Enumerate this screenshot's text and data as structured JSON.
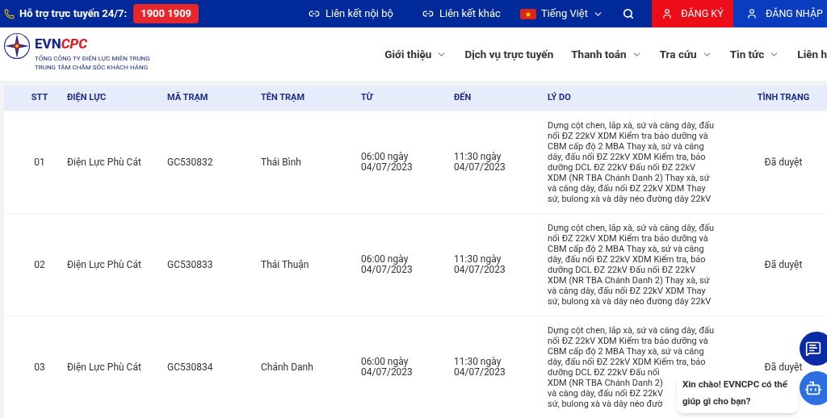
{
  "top_bar": {
    "support_label": "Hỗ trợ trực tuyến 24/7:",
    "hotline": "1900 1909",
    "links": [
      "Liên kết nội bộ",
      "Liên kết khác"
    ],
    "language": "Tiếng Việt",
    "register": "ĐĂNG KÝ",
    "login": "ĐĂNG NHẬP"
  },
  "logo": {
    "brand_a": "EVN",
    "brand_b": "CPC",
    "line_1": "TỔNG CÔNG TY ĐIỆN LỰC MIỀN TRUNG",
    "line_2": "TRUNG TÂM CHĂM SÓC KHÁCH HÀNG"
  },
  "nav": [
    {
      "label": "Giới thiệu",
      "dropdown": true
    },
    {
      "label": "Dịch vụ trực tuyến",
      "dropdown": false
    },
    {
      "label": "Thanh toán",
      "dropdown": true
    },
    {
      "label": "Tra cứu",
      "dropdown": true
    },
    {
      "label": "Tin tức",
      "dropdown": true
    },
    {
      "label": "Liên h",
      "dropdown": false
    }
  ],
  "table": {
    "columns": [
      "STT",
      "ĐIỆN LỰC",
      "MÃ TRẠM",
      "TÊN TRẠM",
      "TỪ",
      "ĐẾN",
      "LÝ DO",
      "TÌNH TRẠNG"
    ],
    "rows": [
      {
        "stt": "01",
        "unit": "Điện Lực Phù Cát",
        "code": "GC530832",
        "name": "Thái Bình",
        "from": "06:00 ngày 04/07/2023",
        "to": "11:30 ngày 04/07/2023",
        "reason": [
          "Dựng cột chen, lắp xà, sứ và căng dây, đấu",
          "nối ĐZ 22kV XDM Kiểm tra bảo dưỡng và",
          "CBM cấp độ 2 MBA Thay xà, sứ và căng",
          "dây, đấu nối ĐZ 22kV XDM Kiểm tra, bảo",
          "dưỡng DCL ĐZ 22kV Đấu nối ĐZ 22kV",
          "XDM (NR TBA Chánh Danh 2) Thay xà, sứ",
          "và căng dây, đấu nối ĐZ 22kV XDM Thay",
          "sứ, bulong xà và dây néo đường dây 22kV"
        ],
        "status": "Đã duyệt"
      },
      {
        "stt": "02",
        "unit": "Điện Lực Phù Cát",
        "code": "GC530833",
        "name": "Thái Thuận",
        "from": "06:00 ngày 04/07/2023",
        "to": "11:30 ngày 04/07/2023",
        "reason": [
          "Dựng cột chen, lắp xà, sứ và căng dây, đấu",
          "nối ĐZ 22kV XDM Kiểm tra bảo dưỡng và",
          "CBM cấp độ 2 MBA Thay xà, sứ và căng",
          "dây, đấu nối ĐZ 22kV XDM Kiểm tra, bảo",
          "dưỡng DCL ĐZ 22kV Đấu nối ĐZ 22kV",
          "XDM (NR TBA Chánh Danh 2) Thay xà, sứ",
          "và căng dây, đấu nối ĐZ 22kV XDM Thay",
          "sứ, bulong xà và dây néo đường dây 22kV"
        ],
        "status": "Đã duyệt"
      },
      {
        "stt": "03",
        "unit": "Điện Lực Phù Cát",
        "code": "GC530834",
        "name": "Chánh Danh",
        "from": "06:00 ngày 04/07/2023",
        "to": "11:30 ngày 04/07/2023",
        "reason": [
          "Dựng cột chen, lắp xà, sứ và căng dây, đấu",
          "nối ĐZ 22kV XDM Kiểm tra bảo dưỡng và",
          "CBM cấp độ 2 MBA Thay xà, sứ và căng",
          "dây, đấu nối ĐZ 22kV XDM Kiểm tra, bảo",
          "dưỡng DCL ĐZ 22kV Đấu nối",
          "XDM (NR TBA Chánh Danh 2)",
          "và căng dây, đấu nối ĐZ 22kV",
          "sứ, bulong xà và dây néo đườ"
        ],
        "status": "Đã duyệt"
      }
    ]
  },
  "chat_bubble": "Xin chào! EVNCPC có thể giúp gì cho bạn?"
}
